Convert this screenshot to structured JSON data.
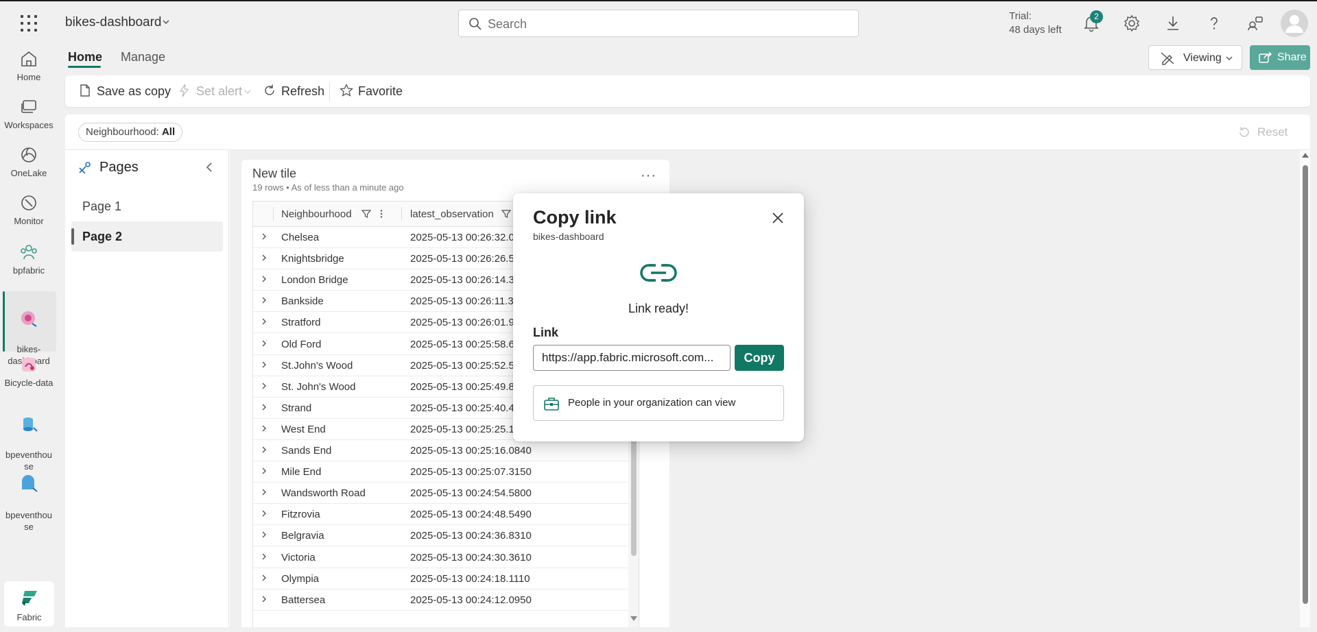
{
  "topbar": {
    "workspace_name": "bikes-dashboard",
    "search_placeholder": "Search",
    "trial_line1": "Trial:",
    "trial_line2": "48 days left",
    "notification_count": "2"
  },
  "rail": {
    "items": [
      {
        "label": "Home",
        "icon": "home-icon"
      },
      {
        "label": "Workspaces",
        "icon": "workspaces-icon"
      },
      {
        "label": "OneLake",
        "icon": "onelake-icon"
      },
      {
        "label": "Monitor",
        "icon": "monitor-icon"
      },
      {
        "label": "bpfabric",
        "icon": "workspace-people-icon"
      },
      {
        "label": "bikes-\ndashboard",
        "icon": "dashboard-icon"
      },
      {
        "label": "Bicycle-data",
        "icon": "eventstream-icon"
      },
      {
        "label": "bpeventhou\nse",
        "icon": "eventhouse-icon"
      },
      {
        "label": "bpeventhou\nse",
        "icon": "kql-database-icon"
      }
    ],
    "more": "...",
    "fabric_label": "Fabric"
  },
  "tabs": {
    "home": "Home",
    "manage": "Manage"
  },
  "header_actions": {
    "viewing": "Viewing",
    "share": "Share"
  },
  "ribbon": {
    "save_as_copy": "Save as copy",
    "set_alert": "Set alert",
    "refresh": "Refresh",
    "favorite": "Favorite"
  },
  "filter": {
    "name": "Neighbourhood:",
    "value": "All",
    "reset": "Reset"
  },
  "pages": {
    "title": "Pages",
    "items": [
      "Page 1",
      "Page 2"
    ],
    "active": "Page 2"
  },
  "tile": {
    "title": "New tile",
    "subtitle": "19 rows • As of less than a minute ago",
    "columns": [
      "Neighbourhood",
      "latest_observation"
    ],
    "rows": [
      [
        "Chelsea",
        "2025-05-13 00:26:32.0"
      ],
      [
        "Knightsbridge",
        "2025-05-13 00:26:26.5"
      ],
      [
        "London Bridge",
        "2025-05-13 00:26:14.3"
      ],
      [
        "Bankside",
        "2025-05-13 00:26:11.3"
      ],
      [
        "Stratford",
        "2025-05-13 00:26:01.9"
      ],
      [
        "Old Ford",
        "2025-05-13 00:25:58.6"
      ],
      [
        "St.John's Wood",
        "2025-05-13 00:25:52.5"
      ],
      [
        "St. John's Wood",
        "2025-05-13 00:25:49.8"
      ],
      [
        "Strand",
        "2025-05-13 00:25:40.4"
      ],
      [
        "West End",
        "2025-05-13 00:25:25.1"
      ],
      [
        "Sands End",
        "2025-05-13 00:25:16.0840"
      ],
      [
        "Mile End",
        "2025-05-13 00:25:07.3150"
      ],
      [
        "Wandsworth Road",
        "2025-05-13 00:24:54.5800"
      ],
      [
        "Fitzrovia",
        "2025-05-13 00:24:48.5490"
      ],
      [
        "Belgravia",
        "2025-05-13 00:24:36.8310"
      ],
      [
        "Victoria",
        "2025-05-13 00:24:30.3610"
      ],
      [
        "Olympia",
        "2025-05-13 00:24:18.1110"
      ],
      [
        "Battersea",
        "2025-05-13 00:24:12.0950"
      ]
    ]
  },
  "dialog": {
    "title": "Copy link",
    "subtitle": "bikes-dashboard",
    "status": "Link ready!",
    "link_label": "Link",
    "link_value": "https://app.fabric.microsoft.com...",
    "copy_button": "Copy",
    "permission": "People in your organization can view"
  },
  "colors": {
    "accent": "#117865",
    "share_button": "#5aa89a",
    "badge": "#1a8478"
  }
}
